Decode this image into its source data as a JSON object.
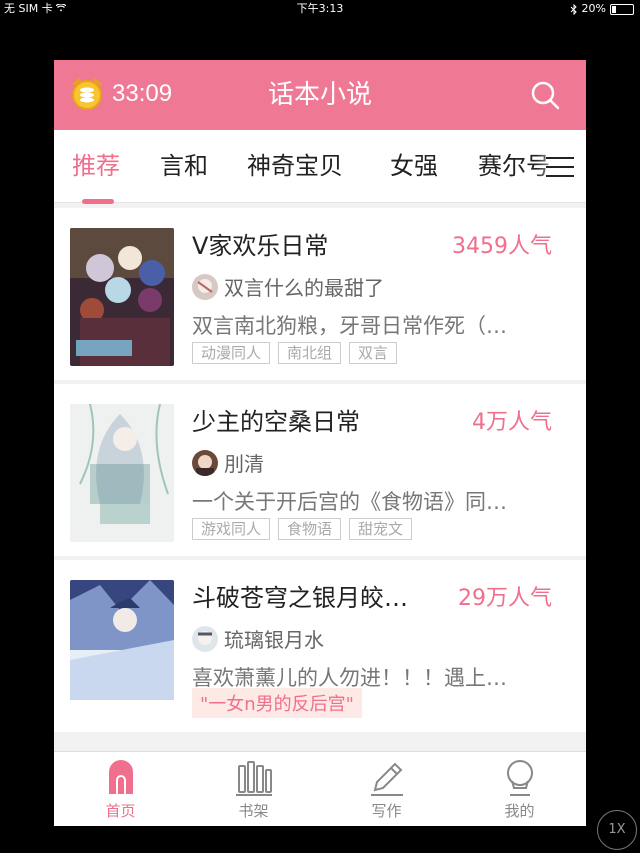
{
  "status_bar": {
    "carrier": "无 SIM 卡",
    "time": "下午3:13",
    "battery": "20%",
    "battery_level": 0.2
  },
  "header": {
    "timer": "33:09",
    "title": "话本小说"
  },
  "tabs": [
    "推荐",
    "言和",
    "神奇宝贝",
    "女强",
    "赛尔号"
  ],
  "active_tab": 0,
  "books": [
    {
      "title": "V家欢乐日常",
      "popularity": "3459人气",
      "author": "双言什么的最甜了",
      "description": "双言南北狗粮，牙哥日常作死（…",
      "tags": [
        "动漫同人",
        "南北组",
        "双言"
      ]
    },
    {
      "title": "少主的空桑日常",
      "popularity": "4万人气",
      "author": "刖清",
      "description": "一个关于开后宫的《食物语》同…",
      "tags": [
        "游戏同人",
        "食物语",
        "甜宠文"
      ]
    },
    {
      "title": "斗破苍穹之银月皎…",
      "popularity": "29万人气",
      "author": "琉璃银月水",
      "description": "喜欢萧薰儿的人勿进！！！遇上…",
      "highlight_tag": "\"一女n男的反后宫\""
    }
  ],
  "bottom_nav": [
    {
      "label": "首页",
      "icon": "home-icon",
      "active": true
    },
    {
      "label": "书架",
      "icon": "bookshelf-icon",
      "active": false
    },
    {
      "label": "写作",
      "icon": "pencil-icon",
      "active": false
    },
    {
      "label": "我的",
      "icon": "profile-icon",
      "active": false
    }
  ],
  "zoom_badge": "1X",
  "colors": {
    "accent": "#ef7894",
    "accent_text": "#ef6f8d",
    "highlight_bg": "#fde9e6"
  }
}
